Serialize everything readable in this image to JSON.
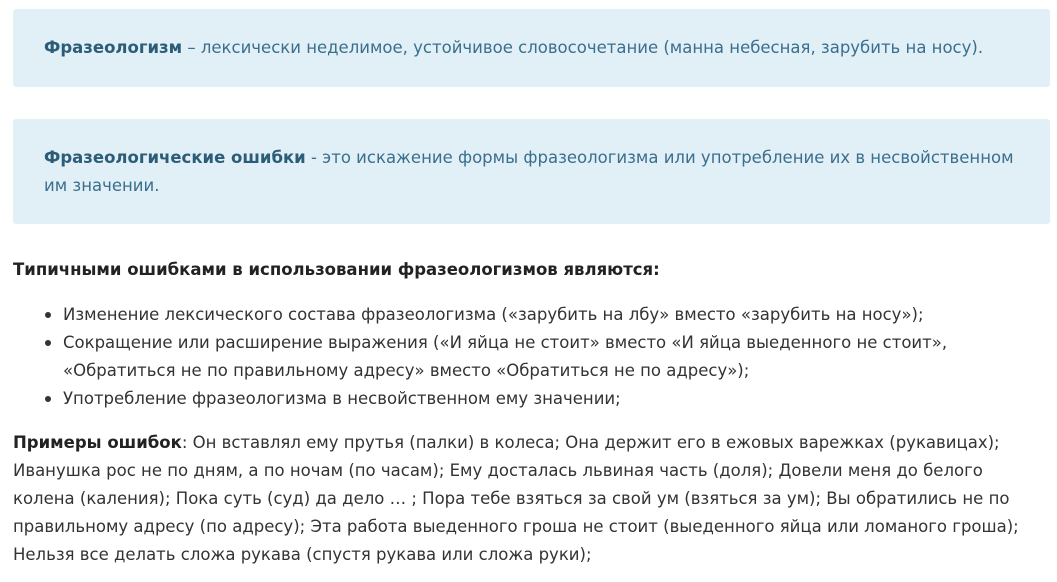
{
  "callouts": [
    {
      "term": "Фразеологизм",
      "text": " – лексически неделимое, устойчивое словосочетание (манна небесная, зарубить на носу)."
    },
    {
      "term": "Фразеологические ошибки",
      "text": " - это искажение формы фразеологизма или употребление их в несвойственном им значении."
    }
  ],
  "intro": "Типичными ошибками в использовании фразеологизмов являются:",
  "list": [
    "Изменение лексического состава фразеологизма («зарубить на лбу» вместо «зарубить на носу»);",
    "Сокращение или расширение выражения («И яйца не стоит» вместо «И яйца выеденного не стоит», «Обратиться не по правильному адресу» вместо «Обратиться не по адресу»);",
    "Употребление фразеологизма в несвойственном ему значении;"
  ],
  "examples": {
    "label": "Примеры ошибок",
    "text": ": Он вставлял ему прутья (палки) в колеса; Она держит его в ежовых варежках (рукавицах); Иванушка рос не по дням, а по ночам (по часам); Ему досталась львиная часть (доля); Довели меня до белого колена (каления); Пока суть (суд) да дело … ; Пора тебе взяться за свой ум (взяться за ум); Вы обратились не по правильному адресу (по адресу); Эта работа выеденного гроша не стоит (выеденного яйца или ломаного гроша); Нельзя все делать сложа рукава (спустя рукава или сложа руки);"
  }
}
